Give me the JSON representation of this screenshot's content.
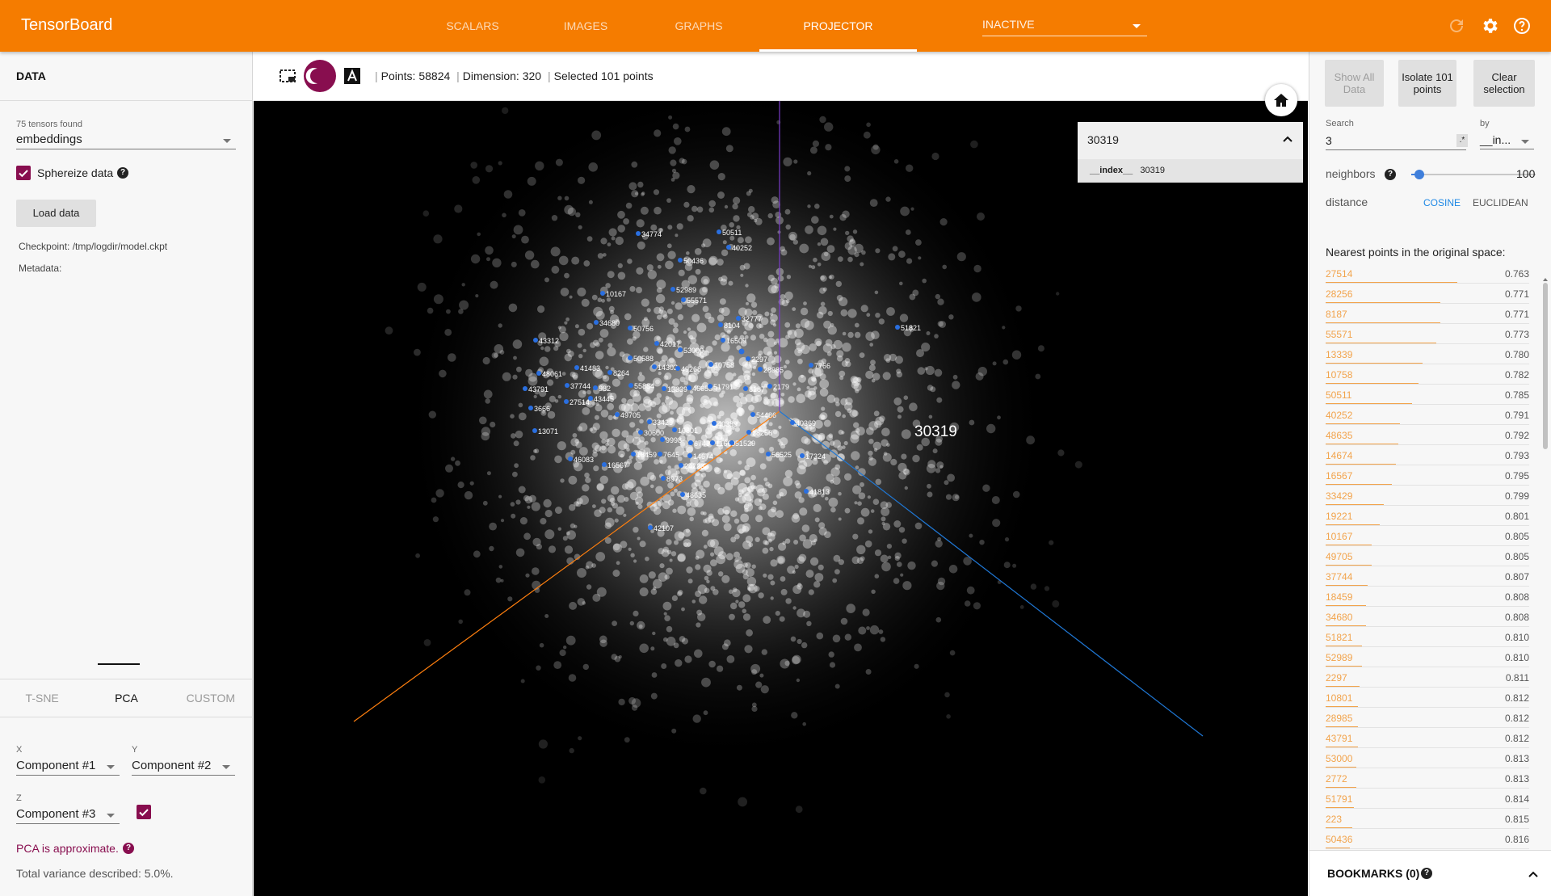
{
  "header": {
    "brand": "TensorBoard",
    "tabs": [
      {
        "label": "SCALARS",
        "active": false
      },
      {
        "label": "IMAGES",
        "active": false
      },
      {
        "label": "GRAPHS",
        "active": false
      },
      {
        "label": "PROJECTOR",
        "active": true
      }
    ],
    "inactive_select": "INACTIVE",
    "icons": [
      "refresh-icon",
      "settings-icon",
      "help-icon"
    ]
  },
  "left_panel": {
    "title": "DATA",
    "tensors_found": "75 tensors found",
    "tensor_select": "embeddings",
    "sphereize_label": "Sphereize data",
    "sphereize_checked": true,
    "load_button": "Load data",
    "checkpoint_label": "Checkpoint:",
    "checkpoint_value": "/tmp/logdir/model.ckpt",
    "metadata_label": "Metadata:",
    "projection_tabs": [
      {
        "label": "T-SNE",
        "active": false
      },
      {
        "label": "PCA",
        "active": true
      },
      {
        "label": "CUSTOM",
        "active": false
      }
    ],
    "x_label": "X",
    "x_value": "Component #1",
    "y_label": "Y",
    "y_value": "Component #2",
    "z_label": "Z",
    "z_value": "Component #3",
    "z_enabled": true,
    "pca_note": "PCA is approximate.",
    "variance": "Total variance described: 5.0%."
  },
  "toolbar": {
    "points": "Points: 58824",
    "dimension": "Dimension: 320",
    "selected": "Selected 101 points",
    "icons": [
      "selection-icon",
      "night-mode-icon",
      "label-toggle-icon"
    ]
  },
  "canvas": {
    "selected_point": "30319",
    "tooltip_key": "__index__",
    "tooltip_value": "30319",
    "axis_colors": {
      "x": "#ff7f0e",
      "y": "#7a3cc8",
      "z": "#1f77d4"
    },
    "labels": [
      "34774",
      "50511",
      "40252",
      "50436",
      "52989",
      "10167",
      "55571",
      "8104",
      "32777",
      "34680",
      "50756",
      "16509",
      "43312",
      "42017",
      "53000",
      "50588",
      "2297",
      "28985",
      "7766",
      "48061",
      "41483",
      "8264",
      "14302",
      "49268",
      "10758",
      "43791",
      "37744",
      "982",
      "55884",
      "13339",
      "46653",
      "51791",
      "8187",
      "2179",
      "27514",
      "43445",
      "3666",
      "49705",
      "33429",
      "40389",
      "54486",
      "40369",
      "13071",
      "30600",
      "10801",
      "28256",
      "9998",
      "6743",
      "11669",
      "51529",
      "56525",
      "17324",
      "46083",
      "18459",
      "7645",
      "14674",
      "16567",
      "24223",
      "8973",
      "41813",
      "48635",
      "42107",
      "51821"
    ]
  },
  "right_panel": {
    "buttons": [
      "Show All Data",
      "Isolate 101 points",
      "Clear selection"
    ],
    "search_label": "Search",
    "search_value": "3",
    "regex_toggle": ".*",
    "by_label": "by",
    "by_value": "__in...",
    "neighbors_label": "neighbors",
    "neighbors_value": "100",
    "distance_label": "distance",
    "distance_cosine": "COSINE",
    "distance_euclidean": "EUCLIDEAN",
    "nn_title": "Nearest points in the original space:",
    "nearest": [
      {
        "index": "27514",
        "value": "0.763"
      },
      {
        "index": "28256",
        "value": "0.771"
      },
      {
        "index": "8187",
        "value": "0.771"
      },
      {
        "index": "55571",
        "value": "0.773"
      },
      {
        "index": "13339",
        "value": "0.780"
      },
      {
        "index": "10758",
        "value": "0.782"
      },
      {
        "index": "50511",
        "value": "0.785"
      },
      {
        "index": "40252",
        "value": "0.791"
      },
      {
        "index": "48635",
        "value": "0.792"
      },
      {
        "index": "14674",
        "value": "0.793"
      },
      {
        "index": "16567",
        "value": "0.795"
      },
      {
        "index": "33429",
        "value": "0.799"
      },
      {
        "index": "19221",
        "value": "0.801"
      },
      {
        "index": "10167",
        "value": "0.805"
      },
      {
        "index": "49705",
        "value": "0.805"
      },
      {
        "index": "37744",
        "value": "0.807"
      },
      {
        "index": "18459",
        "value": "0.808"
      },
      {
        "index": "34680",
        "value": "0.808"
      },
      {
        "index": "51821",
        "value": "0.810"
      },
      {
        "index": "52989",
        "value": "0.810"
      },
      {
        "index": "2297",
        "value": "0.811"
      },
      {
        "index": "10801",
        "value": "0.812"
      },
      {
        "index": "28985",
        "value": "0.812"
      },
      {
        "index": "43791",
        "value": "0.812"
      },
      {
        "index": "53000",
        "value": "0.813"
      },
      {
        "index": "2772",
        "value": "0.813"
      },
      {
        "index": "51791",
        "value": "0.814"
      },
      {
        "index": "223",
        "value": "0.815"
      },
      {
        "index": "50436",
        "value": "0.816"
      }
    ],
    "bookmarks": "BOOKMARKS (0)"
  }
}
